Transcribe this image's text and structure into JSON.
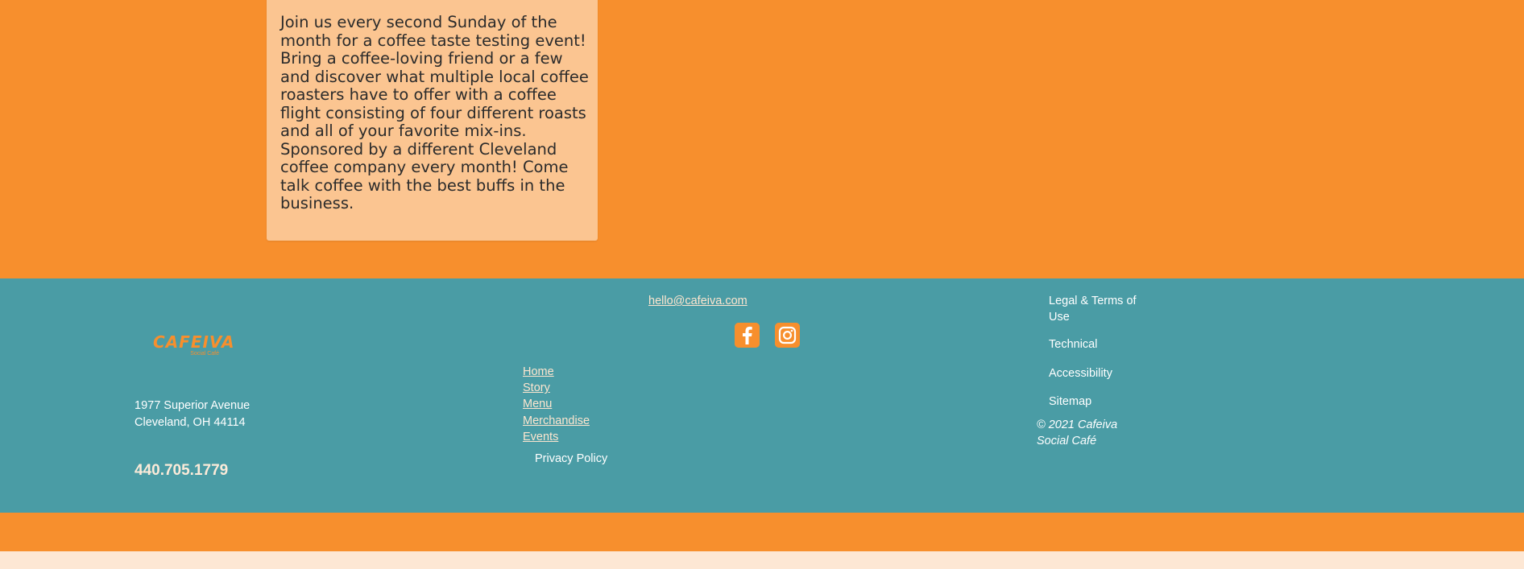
{
  "event": {
    "description": "Join us every second Sunday of the month for a coffee taste testing event! Bring a coffee-loving friend or a few and discover what multiple local coffee roasters have to offer with a coffee flight consisting of four different roasts and all of your favorite mix-ins. Sponsored by a different Cleveland coffee company every month! Come talk coffee with the best buffs in the business."
  },
  "footer": {
    "logo": {
      "name": "CAFEIVA",
      "tagline": "Social Café"
    },
    "address": {
      "line1": "1977 Superior Avenue",
      "line2": "Cleveland, OH 44114"
    },
    "phone": "440.705.1779",
    "email": "hello@cafeiva.com",
    "social": [
      {
        "name": "facebook-icon",
        "color": "#f78f2d"
      },
      {
        "name": "instagram-icon",
        "color": "#f78f2d"
      }
    ],
    "nav": [
      "Home",
      "Story",
      "Menu",
      "Merchandise",
      "Events"
    ],
    "privacy": "Privacy Policy",
    "legal": [
      "Legal & Terms of Use",
      "Technical",
      "Accessibility",
      "Sitemap"
    ],
    "copyright": "© 2021 Cafeiva Social Café"
  },
  "colors": {
    "background": "#f78f2d",
    "footer": "#4a9ca5",
    "card": "#fbc591",
    "bottom_strip": "#fde7d4"
  }
}
